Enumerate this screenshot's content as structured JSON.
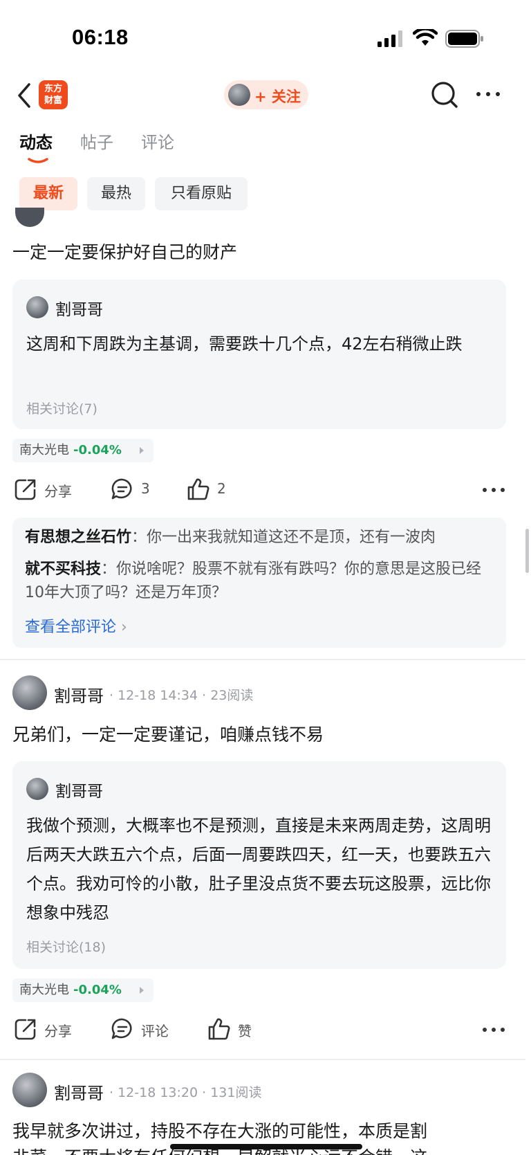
{
  "status_bar": {
    "time": "06:18"
  },
  "nav": {
    "logo_line1": "东方",
    "logo_line2": "财富",
    "follow_label": "+ 关注"
  },
  "tabs": [
    {
      "label": "动态"
    },
    {
      "label": "帖子"
    },
    {
      "label": "评论"
    }
  ],
  "filters": [
    {
      "label": "最新"
    },
    {
      "label": "最热"
    },
    {
      "label": "只看原贴"
    }
  ],
  "colors": {
    "accent": "#f04b1c",
    "down_green": "#1aa45a",
    "link_blue": "#2a6ad8"
  },
  "posts": [
    {
      "text": "一定一定要保护好自己的财产",
      "quote": {
        "author": "割哥哥",
        "text": "这周和下周跌为主基调，需要跌十几个点，42左右稍微止跌",
        "related": "相关讨论(7)"
      },
      "stock": {
        "name": "南大光电",
        "change": "-0.04%"
      },
      "actions": {
        "share": "分享",
        "comments": "3",
        "likes": "2"
      },
      "comments": [
        {
          "user": "有思想之丝石竹",
          "text": "你一出来我就知道这还不是顶，还有一波肉"
        },
        {
          "user": "就不买科技",
          "text": "你说啥呢？股票不就有涨有跌吗？你的意思是这股已经10年大顶了吗？还是万年顶？"
        }
      ],
      "view_all": "查看全部评论"
    },
    {
      "author": "割哥哥",
      "meta": "· 12-18 14:34 · 23阅读",
      "text": "兄弟们，一定一定要谨记，咱赚点钱不易",
      "quote": {
        "author": "割哥哥",
        "text": "我做个预测，大概率也不是预测，直接是未来两周走势，这周明后两天大跌五六个点，后面一周要跌四天，红一天，也要跌五六个点。我劝可怜的小散，肚子里没点货不要去玩这股票，远比你想象中残忍",
        "related": "相关讨论(18)"
      },
      "stock": {
        "name": "南大光电",
        "change": "-0.04%"
      },
      "actions": {
        "share": "分享",
        "comments": "评论",
        "likes": "赞"
      }
    },
    {
      "author": "割哥哥",
      "meta": "· 12-18 13:20 · 131阅读",
      "text_line1": "我早就多次讲过，持股不存在大涨的可能性，本质是割",
      "text_line2": "韭菜，不要太将有任何幻想，早解就当心运不会错，这"
    }
  ]
}
